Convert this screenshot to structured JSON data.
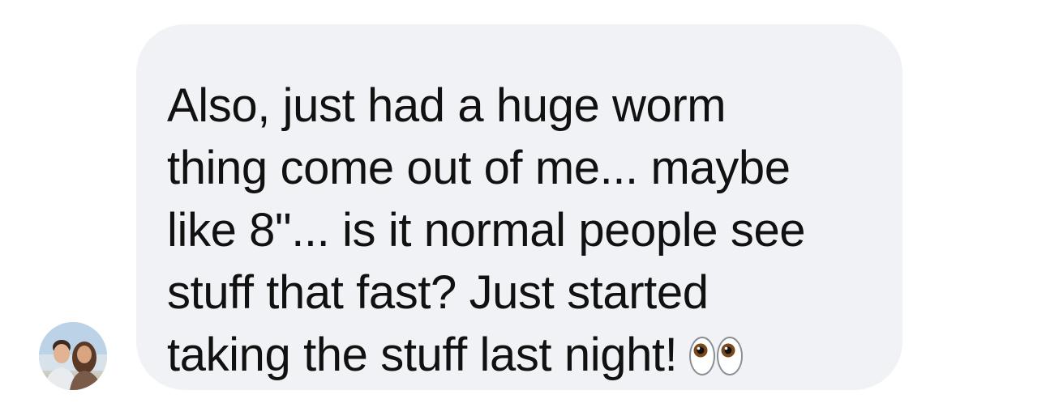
{
  "message": {
    "lines": [
      "Also, just had a huge worm",
      "thing come out of me... maybe",
      "like 8\"... is it normal people see",
      "stuff that fast? Just started",
      "taking the stuff last night!"
    ],
    "emoji": "eyes-emoji"
  },
  "colors": {
    "bubble": "#f1f2f6",
    "text": "#111111",
    "background": "#ffffff"
  }
}
